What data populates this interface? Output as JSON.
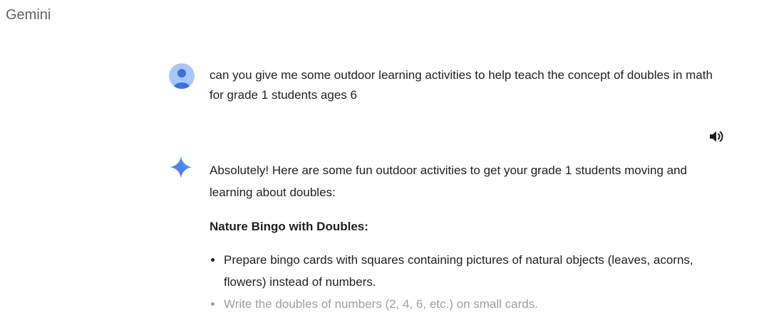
{
  "app": {
    "title": "Gemini"
  },
  "conversation": {
    "user_message": "can you give me some outdoor learning activities to help teach the concept of doubles in math for grade 1 students ages 6",
    "response": {
      "intro": "Absolutely! Here are some fun outdoor activities to get your grade 1 students moving and learning about doubles:",
      "section_heading": "Nature Bingo with Doubles:",
      "bullets": [
        "Prepare bingo cards with squares containing pictures of natural objects (leaves, acorns, flowers) instead of numbers.",
        "Write the doubles of numbers (2, 4, 6, etc.) on small cards."
      ]
    }
  },
  "icons": {
    "user_avatar": "person-avatar-icon",
    "speaker": "speaker-volume-icon",
    "gemini": "gemini-sparkle-icon"
  },
  "colors": {
    "avatar_bg": "#a8c7fa",
    "avatar_fg": "#3c6fe0",
    "text": "#1f1f1f",
    "faded_text": "#9aa0a6",
    "title": "#5f6368"
  }
}
